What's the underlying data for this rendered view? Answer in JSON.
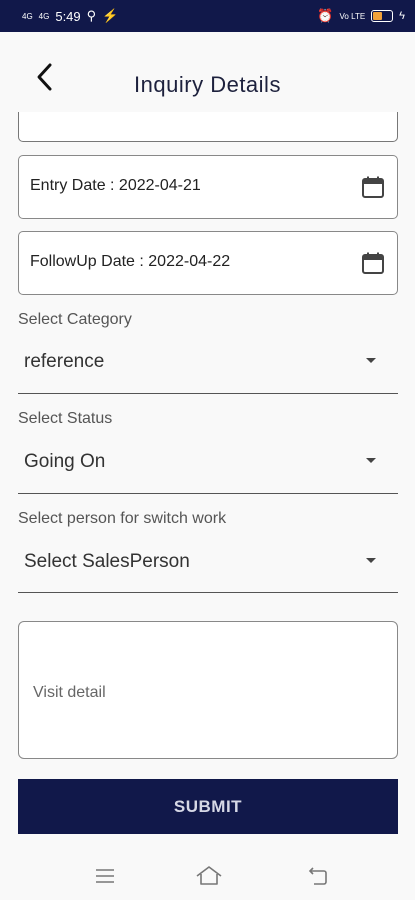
{
  "status_bar": {
    "network": "4G",
    "network2": "4G",
    "time": "5:49",
    "vowifi": "Vo LTE",
    "battery_color": "#f2a23a"
  },
  "header": {
    "title": "Inquiry Details",
    "back_icon": "back-arrow-icon"
  },
  "form": {
    "entry_date": "Entry Date : 2022-04-21",
    "followup_date": "FollowUp Date : 2022-04-22",
    "category": {
      "label": "Select Category",
      "value": "reference"
    },
    "status": {
      "label": "Select Status",
      "value": "Going On"
    },
    "switch_person": {
      "label": "Select person for switch work",
      "value": "Select SalesPerson"
    },
    "visit_detail_placeholder": "Visit detail",
    "submit_label": "SUBMIT"
  },
  "colors": {
    "primary": "#11184a",
    "background": "#f9f9f9"
  }
}
